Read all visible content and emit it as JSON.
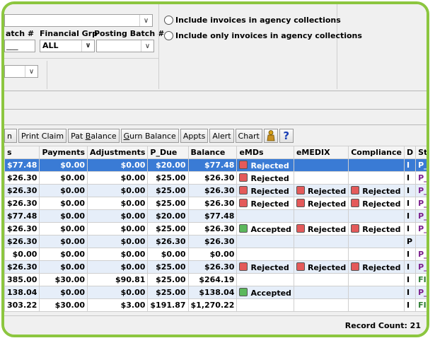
{
  "filters": {
    "labels": {
      "batch": "atch #",
      "financial_grp": "Financial Grp",
      "posting_batch": "Posting Batch #"
    },
    "batch_value": "___",
    "financial_grp_value": "ALL",
    "posting_batch_value": ""
  },
  "options": {
    "include_agency": "Include invoices in agency collections",
    "include_only_agency": "Include only invoices in agency collections"
  },
  "toolbar": {
    "partial_first": "n",
    "print_claim": "Print Claim",
    "pat_balance_a": "Pat ",
    "pat_balance_u": "B",
    "pat_balance_b": "alance",
    "gurn_balance_u": "G",
    "gurn_balance_b": "urn Balance",
    "appts": "Appts",
    "alert": "Alert",
    "chart": "Chart",
    "help_glyph": "?"
  },
  "table": {
    "columns": [
      "s",
      "Payments",
      "Adjustments",
      "P_Due",
      "Balance",
      "eMDs",
      "eMEDIX",
      "Compliance",
      "D",
      "Statu"
    ],
    "rows": [
      {
        "s": "$77.48",
        "payments": "$0.00",
        "adjustments": "$0.00",
        "pdue": "$20.00",
        "balance": "$77.48",
        "emds": "Rejected",
        "emdsColor": "red",
        "emedix": "",
        "emedixColor": "",
        "compliance": "",
        "complianceColor": "",
        "d": "I",
        "status": "P_I"
      },
      {
        "s": "$26.30",
        "payments": "$0.00",
        "adjustments": "$0.00",
        "pdue": "$25.00",
        "balance": "$26.30",
        "emds": "Rejected",
        "emdsColor": "red",
        "emedix": "",
        "emedixColor": "",
        "compliance": "",
        "complianceColor": "",
        "d": "I",
        "status": "P_I"
      },
      {
        "s": "$26.30",
        "payments": "$0.00",
        "adjustments": "$0.00",
        "pdue": "$25.00",
        "balance": "$26.30",
        "emds": "Rejected",
        "emdsColor": "red",
        "emedix": "Rejected",
        "emedixColor": "red",
        "compliance": "Rejected",
        "complianceColor": "red",
        "d": "I",
        "status": "P_I"
      },
      {
        "s": "$26.30",
        "payments": "$0.00",
        "adjustments": "$0.00",
        "pdue": "$25.00",
        "balance": "$26.30",
        "emds": "Rejected",
        "emdsColor": "red",
        "emedix": "Rejected",
        "emedixColor": "red",
        "compliance": "Rejected",
        "complianceColor": "red",
        "d": "I",
        "status": "P_I"
      },
      {
        "s": "$77.48",
        "payments": "$0.00",
        "adjustments": "$0.00",
        "pdue": "$20.00",
        "balance": "$77.48",
        "emds": "",
        "emdsColor": "",
        "emedix": "",
        "emedixColor": "",
        "compliance": "",
        "complianceColor": "",
        "d": "I",
        "status": "P_I"
      },
      {
        "s": "$26.30",
        "payments": "$0.00",
        "adjustments": "$0.00",
        "pdue": "$25.00",
        "balance": "$26.30",
        "emds": "Accepted",
        "emdsColor": "green",
        "emedix": "Rejected",
        "emedixColor": "red",
        "compliance": "Rejected",
        "complianceColor": "red",
        "d": "I",
        "status": "P_I"
      },
      {
        "s": "$26.30",
        "payments": "$0.00",
        "adjustments": "$0.00",
        "pdue": "$26.30",
        "balance": "$26.30",
        "emds": "",
        "emdsColor": "",
        "emedix": "",
        "emedixColor": "",
        "compliance": "",
        "complianceColor": "",
        "d": "P",
        "status": ""
      },
      {
        "s": "$0.00",
        "payments": "$0.00",
        "adjustments": "$0.00",
        "pdue": "$0.00",
        "balance": "$0.00",
        "emds": "",
        "emdsColor": "",
        "emedix": "",
        "emedixColor": "",
        "compliance": "",
        "complianceColor": "",
        "d": "I",
        "status": "P_INS"
      },
      {
        "s": "$26.30",
        "payments": "$0.00",
        "adjustments": "$0.00",
        "pdue": "$25.00",
        "balance": "$26.30",
        "emds": "Rejected",
        "emdsColor": "red",
        "emedix": "Rejected",
        "emedixColor": "red",
        "compliance": "Rejected",
        "complianceColor": "red",
        "d": "I",
        "status": "P_INS"
      },
      {
        "s": "385.00",
        "payments": "$30.00",
        "adjustments": "$90.81",
        "pdue": "$25.00",
        "balance": "$264.19",
        "emds": "",
        "emdsColor": "",
        "emedix": "",
        "emedixColor": "",
        "compliance": "",
        "complianceColor": "",
        "d": "I",
        "status": "FILED"
      },
      {
        "s": "138.04",
        "payments": "$0.00",
        "adjustments": "$0.00",
        "pdue": "$25.00",
        "balance": "$138.04",
        "emds": "Accepted",
        "emdsColor": "green",
        "emedix": "",
        "emedixColor": "",
        "compliance": "",
        "complianceColor": "",
        "d": "I",
        "status": "P_INS"
      },
      {
        "s": "303.22",
        "payments": "$30.00",
        "adjustments": "$3.00",
        "pdue": "$191.87",
        "balance": "$1,270.22",
        "emds": "",
        "emdsColor": "",
        "emedix": "",
        "emedixColor": "",
        "compliance": "",
        "complianceColor": "",
        "d": "I",
        "status": "FILED"
      }
    ]
  },
  "footer": {
    "record_count": "Record Count: 21"
  },
  "colors": {
    "frame": "#8cc63f",
    "selected_row": "#3a7bd5",
    "alt_row": "#e6eef9",
    "rejected": "#e45a5a",
    "accepted": "#5cb85c"
  }
}
